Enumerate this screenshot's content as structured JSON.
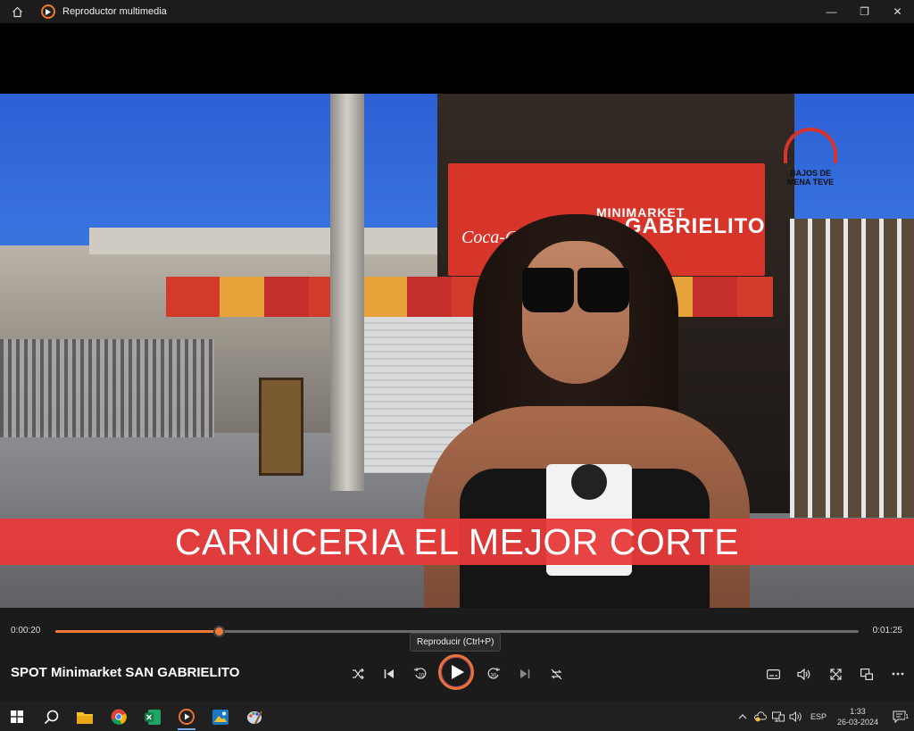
{
  "window": {
    "title": "Reproductor multimedia",
    "controls": {
      "minimize": "—",
      "maximize": "❐",
      "close": "✕"
    }
  },
  "video": {
    "store_sign_line1": "MINIMARKET",
    "store_sign_line2": "GABRIELITO",
    "store_sign_brand": "Coca-Cola",
    "logo_line1": "BAJOS DE",
    "logo_line2": "MENA TEVE",
    "caption": "CARNICERIA EL MEJOR CORTE"
  },
  "player": {
    "current_time": "0:00:20",
    "total_time": "0:01:25",
    "progress_fraction": 0.203,
    "tooltip": "Reproducir (Ctrl+P)",
    "media_title": "SPOT Minimarket SAN GABRIELITO",
    "buttons": [
      "shuffle-icon",
      "previous-icon",
      "rewind-10-icon",
      "play-icon",
      "forward-30-icon",
      "next-icon",
      "repeat-icon",
      "subtitles-icon",
      "volume-icon",
      "fullscreen-icon",
      "miniplayer-icon",
      "more-icon"
    ],
    "accent_color": "#ef7a35"
  },
  "taskbar": {
    "apps": [
      "windows-start-icon",
      "search-icon",
      "file-explorer-icon",
      "chrome-icon",
      "excel-icon",
      "media-player-icon",
      "photos-icon",
      "paint-icon"
    ],
    "language": "ESP",
    "time": "1:33",
    "date": "26-03-2024",
    "notification_count": "1"
  }
}
